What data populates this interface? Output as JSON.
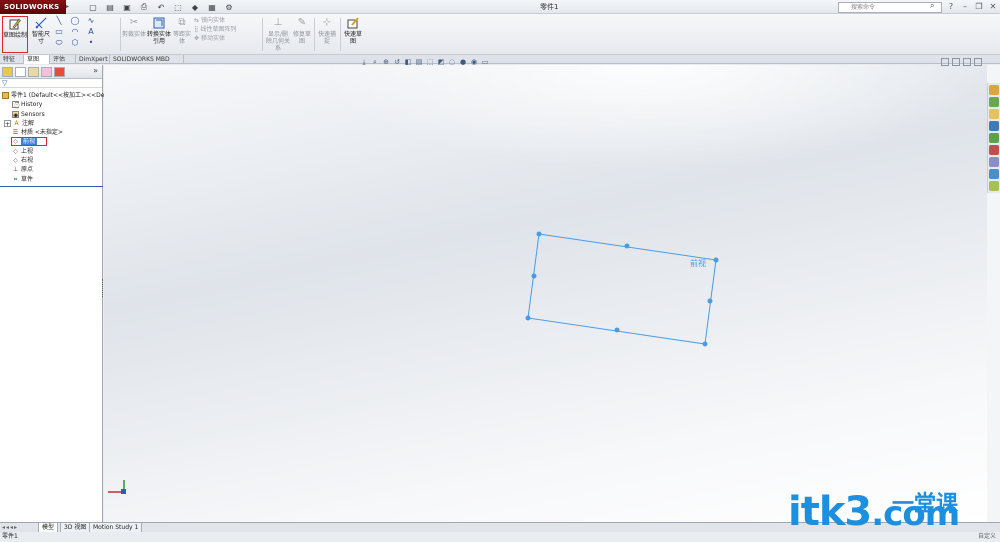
{
  "app": {
    "logo_text": "SOLIDWORKS",
    "document_title": "零件1",
    "search_placeholder": "搜索命令"
  },
  "command_manager": {
    "sketch_button": "草图绘制",
    "smart_dimension": "智能尺寸",
    "trim": "剪裁实体",
    "convert": "转换实体引用",
    "offset": "等距实体",
    "mirror": "镜向实体",
    "linear_pattern": "线性草图阵列",
    "move": "移动实体",
    "display_relations": "显示/删除几何关系",
    "repair": "修复草图",
    "quick_snap": "快速捕捉",
    "rapid_sketch": "快速草图"
  },
  "tabs": [
    "特征",
    "草图",
    "评估",
    "DimXpert",
    "SOLIDWORKS MBD"
  ],
  "active_tab_index": 1,
  "feature_tree": {
    "root": "零件1 (Default<<按加工><<De",
    "items": [
      {
        "label": "History",
        "icon": "history-icon"
      },
      {
        "label": "Sensors",
        "icon": "sensors-icon"
      },
      {
        "label": "注解",
        "icon": "annotations-icon"
      },
      {
        "label": "材质 <未指定>",
        "icon": "material-icon"
      },
      {
        "label": "前视",
        "icon": "plane-icon",
        "selected": true
      },
      {
        "label": "上视",
        "icon": "plane-icon"
      },
      {
        "label": "右视",
        "icon": "plane-icon"
      },
      {
        "label": "原点",
        "icon": "origin-icon"
      },
      {
        "label": "草件",
        "icon": "sketch-icon"
      }
    ]
  },
  "graphics": {
    "plane_label": "前视",
    "plane_color": "#3a8fe0"
  },
  "bottom_tabs": [
    "模型",
    "3D 视图",
    "Motion Study 1"
  ],
  "active_bottom_tab": 0,
  "status": {
    "left": "零件1",
    "right": "自定义"
  },
  "watermark": {
    "main": "itk3",
    "suffix": ".com",
    "chinese": "一堂课"
  }
}
